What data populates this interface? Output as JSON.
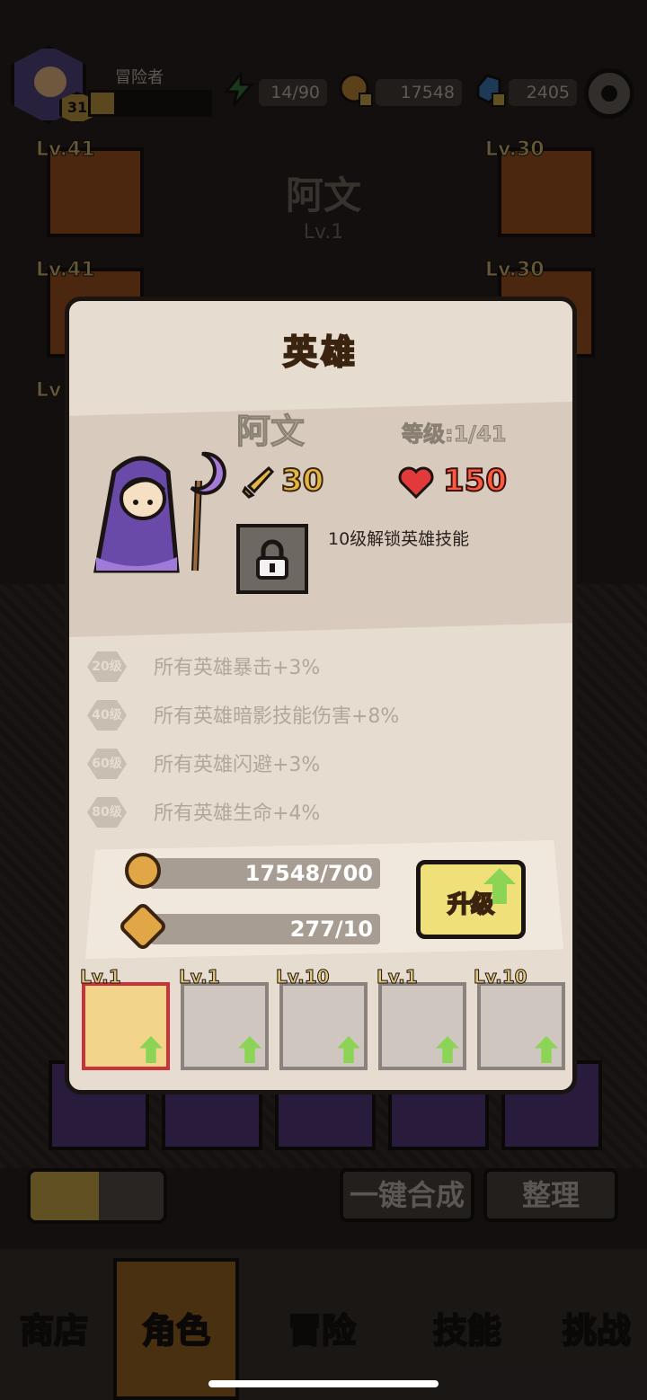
{
  "topbar": {
    "player_name": "冒险者",
    "player_level": "31",
    "xp_progress": 0.2,
    "energy": "14/90",
    "gold": "17548",
    "gems": "2405"
  },
  "background": {
    "hero_name": "阿文",
    "hero_level": "Lv.1",
    "equip_slots": [
      "Lv.41",
      "Lv.30",
      "Lv.41",
      "Lv.30",
      "Lv"
    ],
    "merge_button": "一键合成",
    "sort_button": "整理"
  },
  "nav": {
    "items": [
      "商店",
      "角色",
      "冒险",
      "技能",
      "挑战"
    ]
  },
  "modal": {
    "title": "英雄",
    "hero_name": "阿文",
    "level_text": "等级:1/41",
    "attack": "30",
    "hp": "150",
    "skill_hint": "10级解锁英雄技能",
    "bonuses": [
      {
        "badge": "20级",
        "text": "所有英雄暴击+3%"
      },
      {
        "badge": "40级",
        "text": "所有英雄暗影技能伤害+8%"
      },
      {
        "badge": "60级",
        "text": "所有英雄闪避+3%"
      },
      {
        "badge": "80级",
        "text": "所有英雄生命+4%"
      }
    ],
    "cost_gold": "17548/700",
    "cost_shard": "277/10",
    "upgrade_label": "升级",
    "heroes": [
      {
        "lv": "Lv.1"
      },
      {
        "lv": "Lv.1"
      },
      {
        "lv": "Lv.10"
      },
      {
        "lv": "Lv.1"
      },
      {
        "lv": "Lv.10"
      }
    ]
  },
  "colors": {
    "accent": "#e0a13a",
    "hp": "#ff5a3c",
    "attack": "#e2b641"
  }
}
